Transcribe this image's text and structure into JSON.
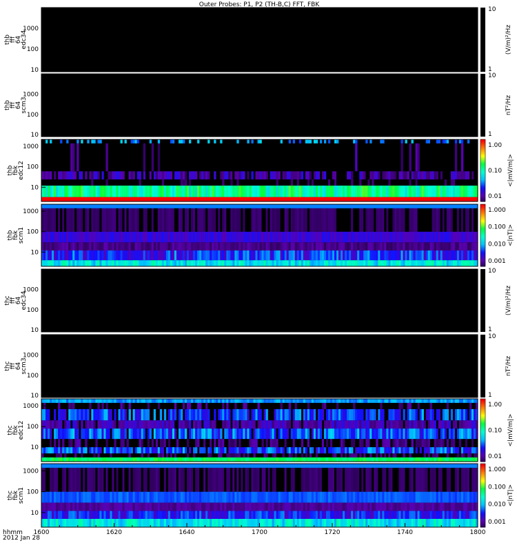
{
  "chart_data": {
    "type": "heatmap",
    "title": "Outer Probes: P1, P2 (TH-B,C) FFT, FBK",
    "xlabel": [
      "hhmm",
      "2012 Jan 28"
    ],
    "x_ticks": [
      "1600",
      "1620",
      "1640",
      "1700",
      "1720",
      "1740",
      "1800"
    ],
    "x_range_minutes": [
      0,
      120
    ],
    "colorscale": [
      "#200040",
      "#5a00b0",
      "#1010ff",
      "#00c0ff",
      "#00ffd0",
      "#00ff40",
      "#ffff00",
      "#ff8000",
      "#ff0000"
    ],
    "panels": [
      {
        "label": [
          "thb",
          "fff",
          "64",
          "edc34"
        ],
        "ylim": [
          8,
          10000
        ],
        "y_ticks": [
          "10",
          "100",
          "1000"
        ],
        "cbar_ticks": [
          "10",
          "1"
        ],
        "cbar_unit": "(V/m)²/Hz",
        "cbar_type": "black",
        "bands": []
      },
      {
        "label": [
          "thb",
          "fff",
          "64",
          "scm3"
        ],
        "ylim": [
          8,
          10000
        ],
        "y_ticks": [
          "10",
          "100",
          "1000"
        ],
        "cbar_ticks": [
          "10",
          "1"
        ],
        "cbar_unit": "nT²/Hz",
        "cbar_type": "black",
        "bands": []
      },
      {
        "label": [
          "thb",
          "fbk",
          "edc12"
        ],
        "ylim": [
          2,
          2200
        ],
        "y_ticks": [
          "10",
          "100",
          "1000"
        ],
        "cbar_ticks": [
          "1.00",
          "0.10",
          "0.01"
        ],
        "cbar_unit": "<|mV/m|>",
        "cbar_type": "color",
        "bands": [
          {
            "f": [
              2,
              3.3
            ],
            "level": 1.0,
            "var": 0.0,
            "fill": 1.0
          },
          {
            "f": [
              3.3,
              12
            ],
            "level": 0.55,
            "var": 0.12,
            "fill": 1.0
          },
          {
            "f": [
              12,
              24
            ],
            "level": 0.02,
            "var": 0.05,
            "fill": 0.4
          },
          {
            "f": [
              24,
              60
            ],
            "level": 0.12,
            "var": 0.1,
            "fill": 0.8
          },
          {
            "f": [
              60,
              1400
            ],
            "level": 0.05,
            "var": 0.1,
            "fill": 0.1
          },
          {
            "f": [
              1400,
              2200
            ],
            "level": 0.35,
            "var": 0.08,
            "fill": 0.35
          }
        ]
      },
      {
        "label": [
          "thb",
          "fbk",
          "scm1"
        ],
        "ylim": [
          2,
          2200
        ],
        "y_ticks": [
          "10",
          "100",
          "1000"
        ],
        "cbar_ticks": [
          "1.000",
          "0.100",
          "0.010",
          "0.001"
        ],
        "cbar_unit": "<|nT|>",
        "cbar_type": "color",
        "bands": [
          {
            "f": [
              2,
              4
            ],
            "level": 0.45,
            "var": 0.1,
            "fill": 1.0
          },
          {
            "f": [
              4,
              12
            ],
            "level": 0.25,
            "var": 0.12,
            "fill": 1.0
          },
          {
            "f": [
              12,
              30
            ],
            "level": 0.08,
            "var": 0.05,
            "fill": 1.0
          },
          {
            "f": [
              30,
              100
            ],
            "level": 0.18,
            "var": 0.05,
            "fill": 1.0
          },
          {
            "f": [
              100,
              1400
            ],
            "level": 0.04,
            "var": 0.03,
            "fill": 1.0
          },
          {
            "f": [
              1400,
              2200
            ],
            "level": 0.33,
            "var": 0.0,
            "fill": 1.0
          }
        ]
      },
      {
        "label": [
          "thc",
          "fff",
          "64",
          "edc34"
        ],
        "ylim": [
          8,
          10000
        ],
        "y_ticks": [
          "10",
          "100",
          "1000"
        ],
        "cbar_ticks": [
          "10",
          "1"
        ],
        "cbar_unit": "(V/m)²/Hz",
        "cbar_type": "black",
        "bands": []
      },
      {
        "label": [
          "thc",
          "fff",
          "64",
          "scm3"
        ],
        "ylim": [
          8,
          10000
        ],
        "y_ticks": [
          "10",
          "100",
          "1000"
        ],
        "cbar_ticks": [
          "10",
          "1"
        ],
        "cbar_unit": "nT²/Hz",
        "cbar_type": "black",
        "bands": []
      },
      {
        "label": [
          "thc",
          "fbk",
          "edc12"
        ],
        "ylim": [
          2,
          2200
        ],
        "y_ticks": [
          "10",
          "100",
          "1000"
        ],
        "cbar_ticks": [
          "1.00",
          "0.10",
          "0.01"
        ],
        "cbar_unit": "<|mV/m|>",
        "cbar_type": "color",
        "bands": [
          {
            "f": [
              2,
              3.2
            ],
            "level": 0.6,
            "var": 0.05,
            "fill": 1.0
          },
          {
            "f": [
              3.2,
              5
            ],
            "level": 0.05,
            "var": 0.05,
            "fill": 0.6
          },
          {
            "f": [
              5,
              10
            ],
            "level": 0.28,
            "var": 0.12,
            "fill": 0.9
          },
          {
            "f": [
              10,
              25
            ],
            "level": 0.06,
            "var": 0.08,
            "fill": 0.7
          },
          {
            "f": [
              25,
              80
            ],
            "level": 0.3,
            "var": 0.12,
            "fill": 0.9
          },
          {
            "f": [
              80,
              200
            ],
            "level": 0.14,
            "var": 0.08,
            "fill": 0.9
          },
          {
            "f": [
              200,
              700
            ],
            "level": 0.28,
            "var": 0.1,
            "fill": 0.8
          },
          {
            "f": [
              700,
              1400
            ],
            "level": 0.05,
            "var": 0.1,
            "fill": 0.3
          },
          {
            "f": [
              1400,
              2200
            ],
            "level": 0.35,
            "var": 0.05,
            "fill": 1.0
          }
        ]
      },
      {
        "label": [
          "thc",
          "fbk",
          "scm1"
        ],
        "ylim": [
          2,
          2200
        ],
        "y_ticks": [
          "10",
          "100",
          "1000"
        ],
        "cbar_ticks": [
          "1.000",
          "0.100",
          "0.010",
          "0.001"
        ],
        "cbar_unit": "<|nT|>",
        "cbar_type": "color",
        "bands": [
          {
            "f": [
              2,
              5
            ],
            "level": 0.45,
            "var": 0.1,
            "fill": 1.0
          },
          {
            "f": [
              5,
              12
            ],
            "level": 0.24,
            "var": 0.1,
            "fill": 1.0
          },
          {
            "f": [
              12,
              30
            ],
            "level": 0.1,
            "var": 0.04,
            "fill": 1.0
          },
          {
            "f": [
              30,
              100
            ],
            "level": 0.3,
            "var": 0.03,
            "fill": 1.0
          },
          {
            "f": [
              100,
              1400
            ],
            "level": 0.04,
            "var": 0.03,
            "fill": 1.0
          },
          {
            "f": [
              1400,
              2200
            ],
            "level": 0.33,
            "var": 0.0,
            "fill": 1.0
          }
        ]
      }
    ]
  }
}
